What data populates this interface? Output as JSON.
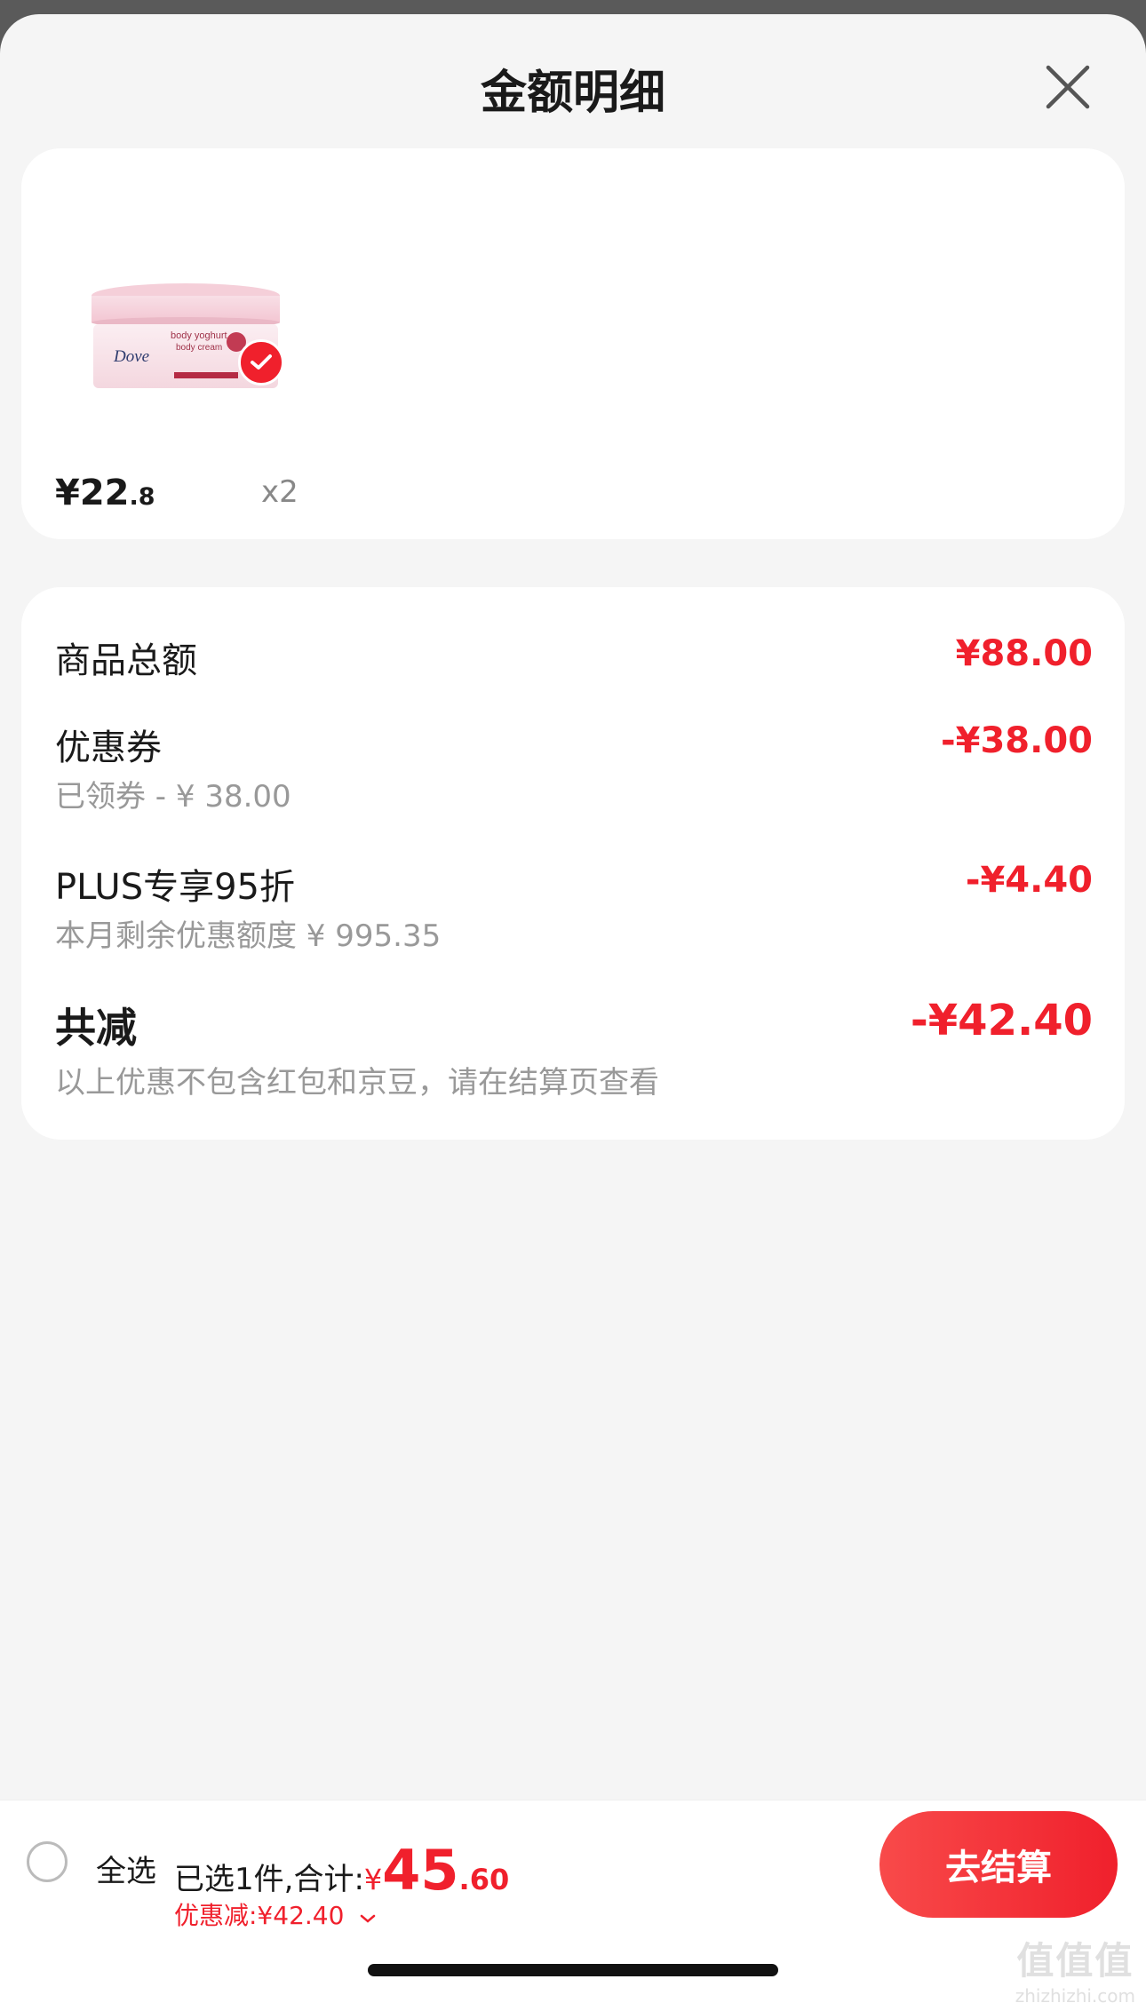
{
  "header": {
    "title": "金额明细"
  },
  "product": {
    "price_int": "¥22",
    "price_dec": ".8",
    "quantity": "x2",
    "image": {
      "brand": "Dove",
      "line1": "body yoghurt",
      "line2": "body cream"
    }
  },
  "details": {
    "goods_total": {
      "label": "商品总额",
      "amount": "¥88.00"
    },
    "coupon": {
      "label": "优惠券",
      "sub": "已领券 - ¥ 38.00",
      "amount": "-¥38.00"
    },
    "plus": {
      "label": "PLUS专享95折",
      "sub": "本月剩余优惠额度  ¥ 995.35",
      "amount": "-¥4.40"
    },
    "total": {
      "label": "共减",
      "amount": "-¥42.40",
      "note": "以上优惠不包含红包和京豆，请在结算页查看"
    }
  },
  "bottom": {
    "select_all": "全选",
    "selected_prefix": "已选1件,合计:",
    "sum_currency": "¥",
    "sum_int": "45",
    "sum_dec": ".60",
    "discount": "优惠减:¥42.40",
    "checkout": "去结算"
  },
  "watermark": {
    "main": "值值值",
    "sub": "zhizhizhi.com"
  },
  "colors": {
    "accent": "#f0202c",
    "background": "#f5f5f5"
  }
}
